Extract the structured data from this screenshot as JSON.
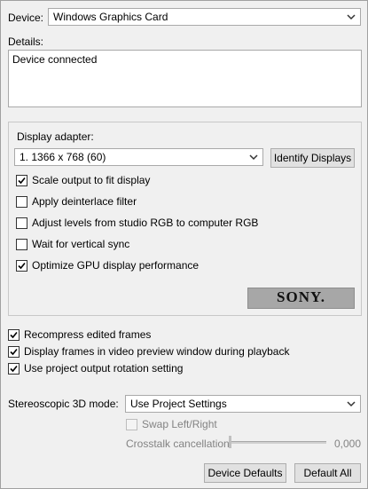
{
  "device": {
    "label": "Device:",
    "value": "Windows Graphics Card"
  },
  "details": {
    "label": "Details:",
    "text": "Device connected"
  },
  "display": {
    "adapter_label": "Display adapter:",
    "adapter_value": "1. 1366 x 768 (60)",
    "identify_button": "Identify Displays",
    "options": [
      {
        "label": "Scale output to fit display",
        "checked": true
      },
      {
        "label": "Apply deinterlace filter",
        "checked": false
      },
      {
        "label": "Adjust levels from studio RGB to computer RGB",
        "checked": false
      },
      {
        "label": "Wait for vertical sync",
        "checked": false
      },
      {
        "label": "Optimize GPU display performance",
        "checked": true
      }
    ],
    "logo_text": "SONY."
  },
  "general_options": [
    {
      "label": "Recompress edited frames",
      "checked": true
    },
    {
      "label": "Display frames in video preview window during playback",
      "checked": true
    },
    {
      "label": "Use project output rotation setting",
      "checked": true
    }
  ],
  "stereo": {
    "label": "Stereoscopic 3D mode:",
    "value": "Use Project Settings",
    "swap_label": "Swap Left/Right",
    "swap_checked": false,
    "crosstalk_label": "Crosstalk cancellation:",
    "crosstalk_value": "0,000",
    "crosstalk_level": 0
  },
  "buttons": {
    "device_defaults": "Device Defaults",
    "default_all": "Default All"
  }
}
